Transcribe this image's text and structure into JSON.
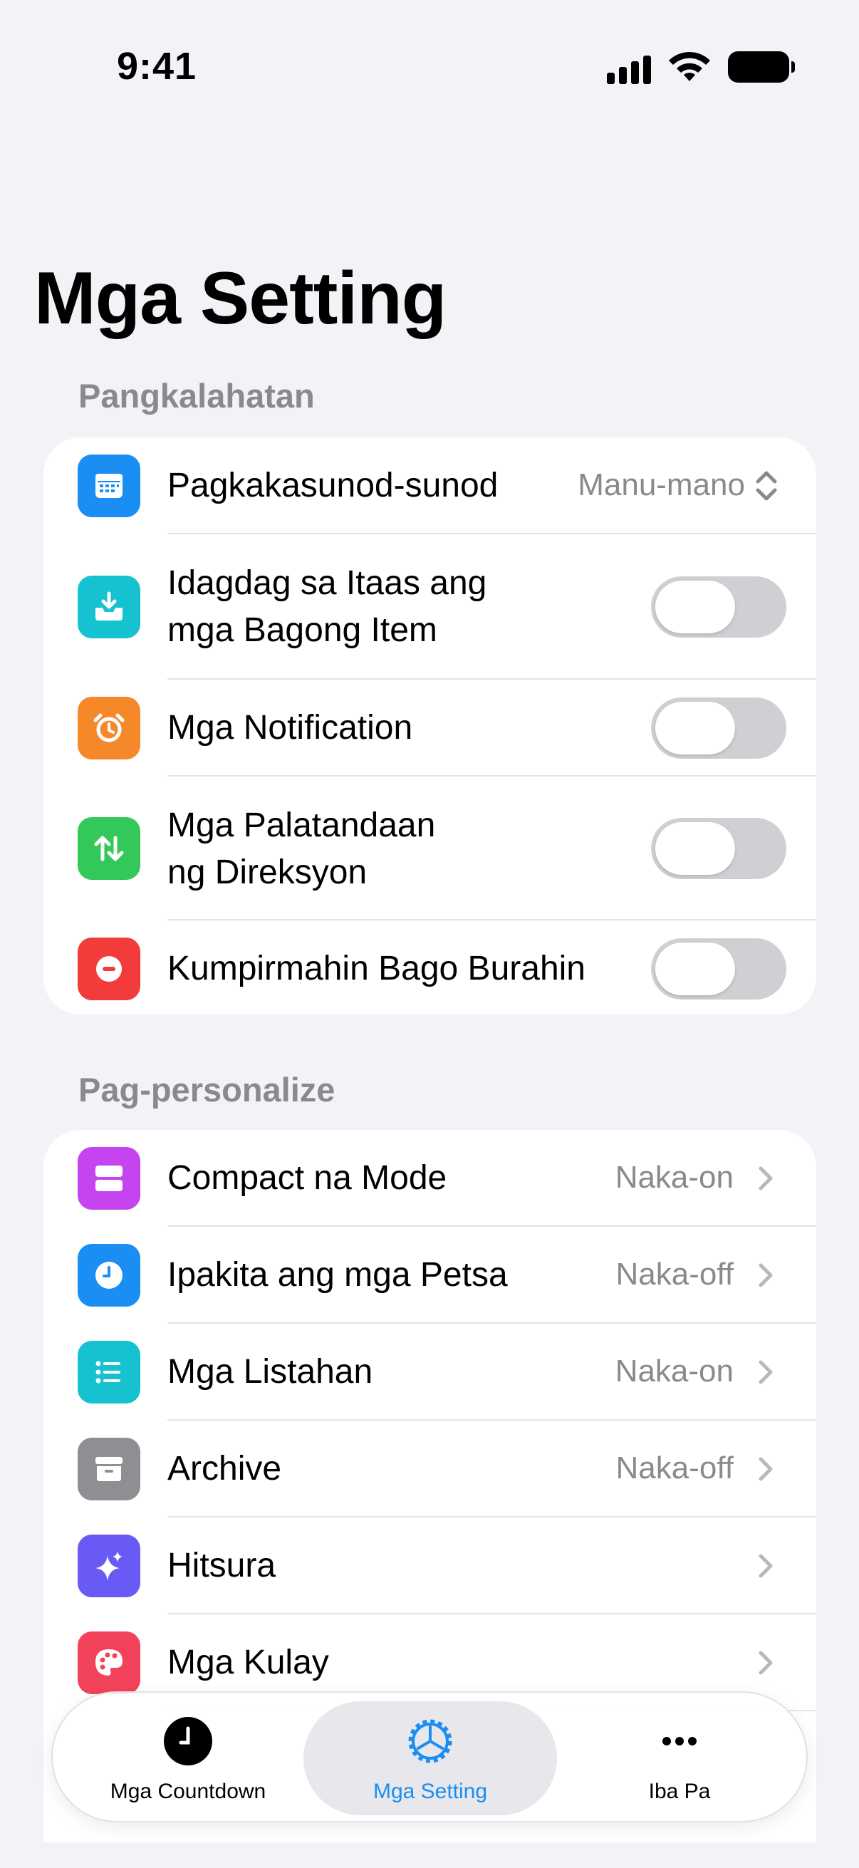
{
  "status_bar": {
    "time": "9:41"
  },
  "page_title": "Mga Setting",
  "general": {
    "header": "Pangkalahatan",
    "sort": {
      "label": "Pagkakasunod-sunod",
      "value": "Manu-mano"
    },
    "add_top": {
      "label_line1": "Idagdag sa Itaas ang",
      "label_line2": "mga Bagong Item",
      "on": false
    },
    "notifications": {
      "label": "Mga Notification",
      "on": false
    },
    "direction": {
      "label_line1": "Mga Palatandaan",
      "label_line2": "ng Direksyon",
      "on": false
    },
    "confirm_delete": {
      "label": "Kumpirmahin Bago Burahin",
      "on": false
    }
  },
  "personalize": {
    "header": "Pag-personalize",
    "items": [
      {
        "label": "Compact na Mode",
        "value": "Naka-on",
        "color": "#c644f0"
      },
      {
        "label": "Ipakita ang mga Petsa",
        "value": "Naka-off",
        "color": "#1a8ef2"
      },
      {
        "label": "Mga Listahan",
        "value": "Naka-on",
        "color": "#16c2d0"
      },
      {
        "label": "Archive",
        "value": "Naka-off",
        "color": "#8e8e93"
      },
      {
        "label": "Hitsura",
        "value": "",
        "color": "#6a5af5"
      },
      {
        "label": "Mga Kulay",
        "value": "",
        "color": "#f2435a"
      }
    ]
  },
  "tabbar": {
    "countdown": "Mga Countdown",
    "settings": "Mga Setting",
    "more": "Iba Pa"
  },
  "colors": {
    "accent": "#1a8ef2",
    "background": "#f2f2f7"
  }
}
